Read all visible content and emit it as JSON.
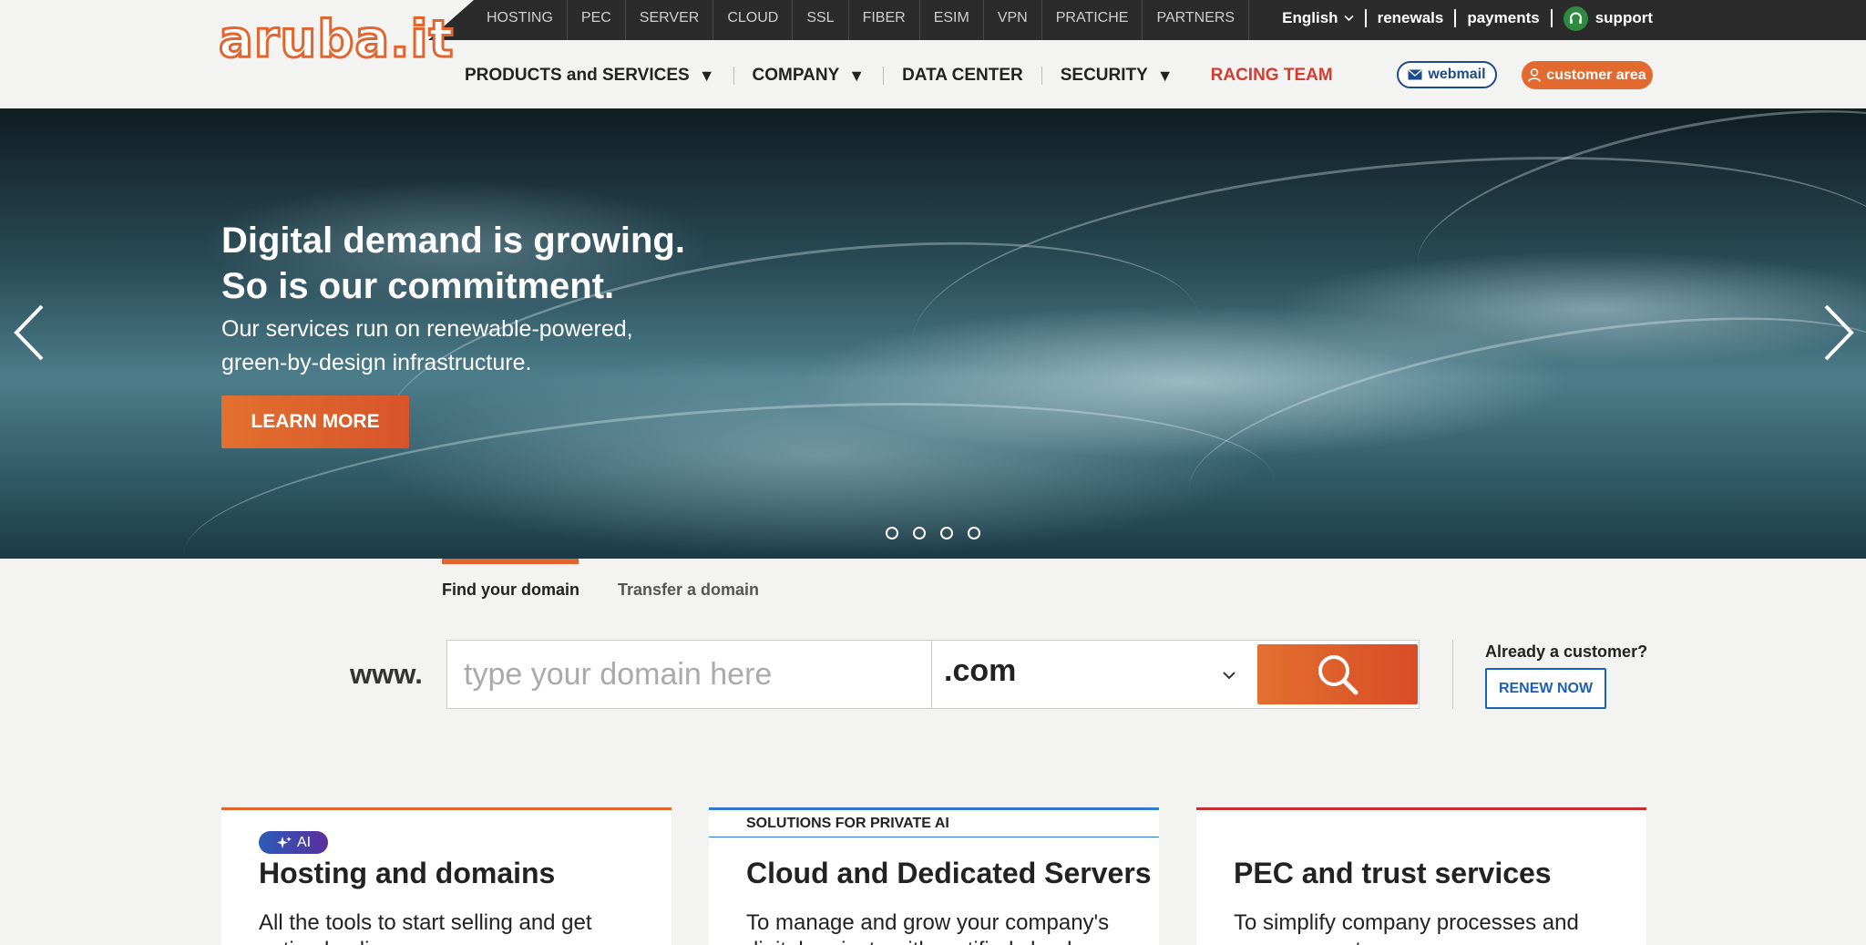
{
  "brand": {
    "logo_text": "aruba.it",
    "accent": "#e2652f"
  },
  "topnav": [
    "HOSTING",
    "PEC",
    "SERVER",
    "CLOUD",
    "SSL",
    "FIBER",
    "ESIM",
    "VPN",
    "PRATICHE",
    "PARTNERS"
  ],
  "topright": {
    "language": "English",
    "renewals": "renewals",
    "payments": "payments",
    "support": "support"
  },
  "mainnav": {
    "products": "PRODUCTS and SERVICES",
    "company": "COMPANY",
    "datacenter": "DATA CENTER",
    "security": "SECURITY",
    "racing": "RACING TEAM",
    "caret": "▼",
    "webmail": "webmail",
    "customer_area": "customer area"
  },
  "hero": {
    "title_line1": "Digital demand is growing.",
    "title_line2": "So is our commitment.",
    "subtitle_line1": "Our services run on renewable-powered,",
    "subtitle_line2": "green-by-design infrastructure.",
    "cta": "LEARN MORE",
    "slide_count": 4
  },
  "domain": {
    "tab_find": "Find your domain",
    "tab_transfer": "Transfer a domain",
    "prefix": "www.",
    "placeholder": "type your domain here",
    "tld": ".com",
    "already_customer": "Already a customer?",
    "renew": "RENEW NOW"
  },
  "cards": [
    {
      "badge": "AI",
      "title": "Hosting and domains",
      "text": "All the tools to start selling and get noticed online"
    },
    {
      "label": "SOLUTIONS FOR PRIVATE AI",
      "title": "Cloud and Dedicated Servers",
      "text": "To manage and grow your company's digital projects with certified cloud"
    },
    {
      "title": "PEC and trust services",
      "text": "To simplify company processes and management"
    }
  ]
}
